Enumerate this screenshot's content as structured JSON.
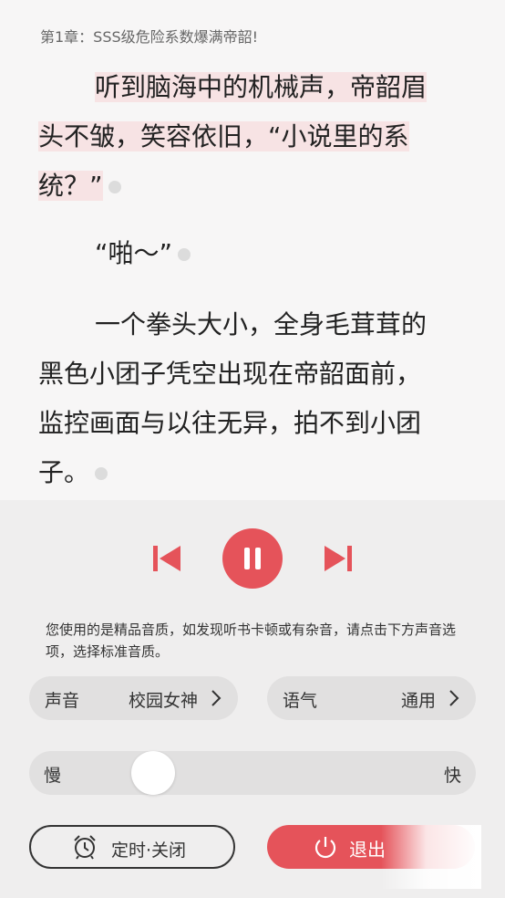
{
  "chapter_title": "第1章：SSS级危险系数爆满帝韶!",
  "text_lines": [
    "听到脑海中的机械声，帝韶眉",
    "头不皱，笑容依旧，“小说里的系",
    "统？”",
    "“啪～”",
    "一个拳头大小，全身毛茸茸的",
    "黑色小团子凭空出现在帝韶面前，",
    "监控画面与以往无异，拍不到小团",
    "子。"
  ],
  "player": {
    "prev_icon": "skip-previous-icon",
    "play_icon": "pause-icon",
    "next_icon": "skip-next-icon"
  },
  "notice": "您使用的是精品音质，如发现听书卡顿或有杂音，请点击下方声音选项，选择标准音质。",
  "voice": {
    "label": "声音",
    "value": "校园女神"
  },
  "tone": {
    "label": "语气",
    "value": "通用"
  },
  "speed": {
    "slow_label": "慢",
    "fast_label": "快",
    "level": 0.14
  },
  "timer": {
    "label": "定时·关闭",
    "icon": "alarm-clock-icon"
  },
  "exit": {
    "label": "退出",
    "icon": "power-icon"
  },
  "colors": {
    "accent": "#e5535a",
    "highlight": "#f7e3e4",
    "panel": "#efeeee"
  }
}
